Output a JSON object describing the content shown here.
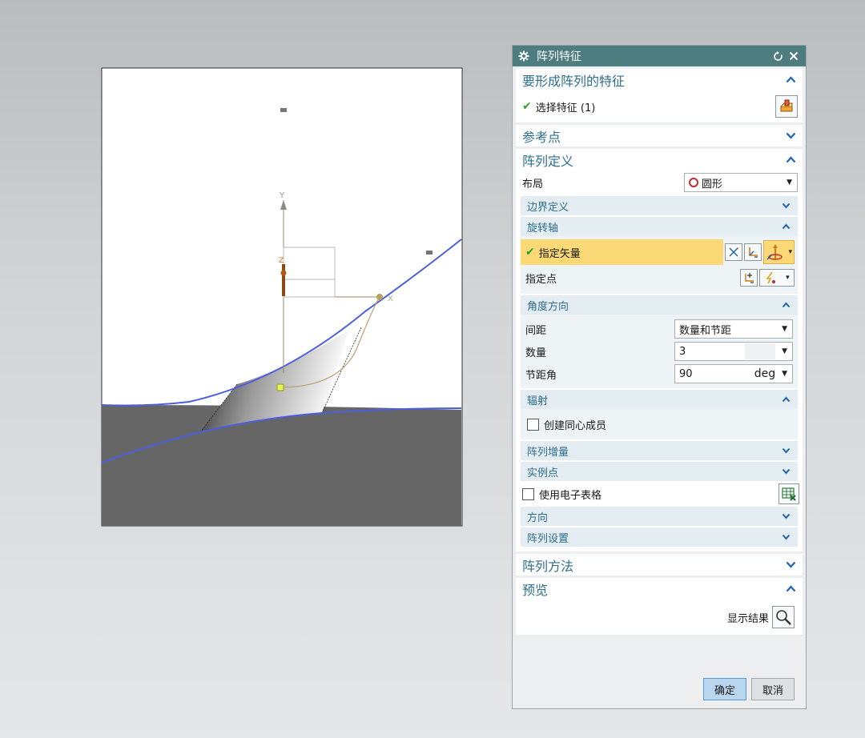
{
  "dialog": {
    "title": "阵列特征",
    "groups": {
      "feature": {
        "title": "要形成阵列的特征",
        "select_label": "选择特征 (1)"
      },
      "refpoint": {
        "title": "参考点"
      },
      "pattern_def": {
        "title": "阵列定义",
        "layout_label": "布局",
        "layout_value": "圆形"
      },
      "pattern_method": {
        "title": "阵列方法"
      },
      "preview": {
        "title": "预览",
        "show_result_label": "显示结果"
      }
    },
    "subgroups": {
      "boundary": "边界定义",
      "rotation_axis": "旋转轴",
      "angle_direction": "角度方向",
      "radiate": "辐射",
      "pattern_increment": "阵列增量",
      "instance_points": "实例点",
      "direction": "方向",
      "pattern_settings": "阵列设置"
    },
    "rotation_axis": {
      "vector_label": "指定矢量",
      "point_label": "指定点"
    },
    "angle_direction": {
      "spacing_label": "间距",
      "spacing_value": "数量和节距",
      "count_label": "数量",
      "count_value": "3",
      "pitch_label": "节距角",
      "pitch_value": "90",
      "pitch_unit": "deg"
    },
    "radiate": {
      "concentric_label": "创建同心成员"
    },
    "spreadsheet_label": "使用电子表格",
    "buttons": {
      "ok": "确定",
      "cancel": "取消"
    }
  },
  "viewport": {
    "axis_labels": {
      "y": "Y",
      "x": "X",
      "z": "Z"
    }
  },
  "colors": {
    "titlebar": "#4e7d80",
    "section_text": "#2e6f8e",
    "highlight_row": "#fcd977",
    "ok_button": "#b9d6ef",
    "curve_blue": "#4b5fe0",
    "solid_gray": "#666666"
  }
}
